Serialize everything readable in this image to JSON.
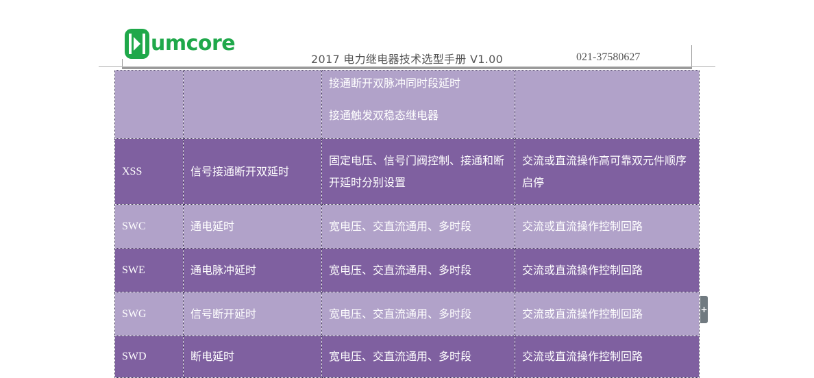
{
  "header": {
    "logo_text": "umcore",
    "title": "2017 电力继电器技术选型手册 V1.00",
    "phone": "021-37580627"
  },
  "colors": {
    "brand_green": "#1fa84a",
    "row_light": "#b1a2c9",
    "row_dark": "#7f60a0"
  },
  "table": {
    "rows": [
      {
        "code": "",
        "name": "",
        "feature_lines": [
          "接通断开双脉冲同时段延时",
          "接通触发双稳态继电器"
        ],
        "application": ""
      },
      {
        "code": "XSS",
        "name": "信号接通断开双延时",
        "feature": "固定电压、信号门阀控制、接通和断开延时分别设置",
        "application": "交流或直流操作高可靠双元件顺序启停"
      },
      {
        "code": "SWC",
        "name": "通电延时",
        "feature": "宽电压、交直流通用、多时段",
        "application": "交流或直流操作控制回路"
      },
      {
        "code": "SWE",
        "name": "通电脉冲延时",
        "feature": "宽电压、交直流通用、多时段",
        "application": "交流或直流操作控制回路"
      },
      {
        "code": "SWG",
        "name": "信号断开延时",
        "feature": "宽电压、交直流通用、多时段",
        "application": "交流或直流操作控制回路"
      },
      {
        "code": "SWD",
        "name": "断电延时",
        "feature": "宽电压、交直流通用、多时段",
        "application": "交流或直流操作控制回路"
      }
    ]
  },
  "scroll_tab": {
    "icon": "plus-icon",
    "glyph": "+"
  }
}
